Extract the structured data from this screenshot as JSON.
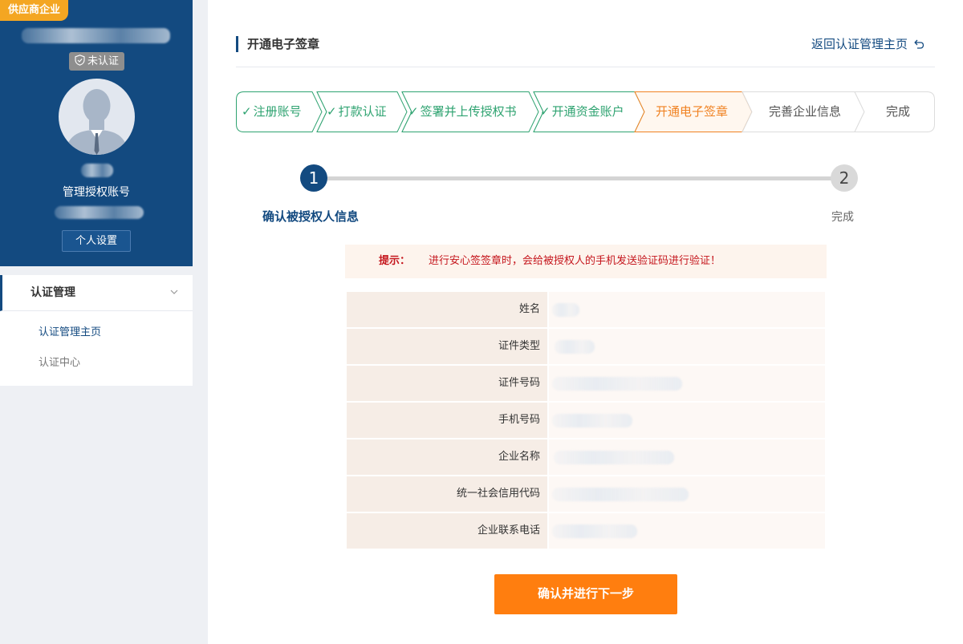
{
  "sidebar": {
    "enterprise_badge": "供应商企业",
    "status_badge": "未认证",
    "role_label": "管理授权账号",
    "settings_button": "个人设置",
    "menu": {
      "section_label": "认证管理",
      "items": [
        {
          "label": "认证管理主页"
        },
        {
          "label": "认证中心"
        }
      ]
    }
  },
  "header": {
    "title": "开通电子签章",
    "back_link": "返回认证管理主页"
  },
  "steps": [
    {
      "label": "注册账号",
      "status": "done"
    },
    {
      "label": "打款认证",
      "status": "done"
    },
    {
      "label": "签署并上传授权书",
      "status": "done"
    },
    {
      "label": "开通资金账户",
      "status": "done"
    },
    {
      "label": "开通电子签章",
      "status": "active"
    },
    {
      "label": "完善企业信息",
      "status": "todo"
    },
    {
      "label": "完成",
      "status": "todo"
    }
  ],
  "progress": {
    "step1_number": "1",
    "step1_label": "确认被授权人信息",
    "step2_number": "2",
    "step2_label": "完成"
  },
  "tip": {
    "label": "提示：",
    "text": "进行安心签签章时，会给被授权人的手机发送验证码进行验证！"
  },
  "fields": [
    {
      "label": "姓名"
    },
    {
      "label": "证件类型"
    },
    {
      "label": "证件号码"
    },
    {
      "label": "手机号码"
    },
    {
      "label": "企业名称"
    },
    {
      "label": "统一社会信用代码"
    },
    {
      "label": "企业联系电话"
    }
  ],
  "confirm_button": "确认并进行下一步",
  "colors": {
    "primary": "#134a80",
    "accent_orange": "#ff7e0f",
    "done_green": "#2fa371",
    "active_orange": "#f08222",
    "badge_yellow": "#f4a622",
    "tip_red": "#c5161d"
  }
}
